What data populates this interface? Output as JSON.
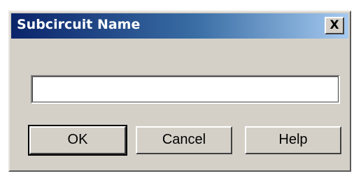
{
  "window": {
    "title": "Subcircuit Name",
    "close_label": "X"
  },
  "form": {
    "name_value": ""
  },
  "buttons": {
    "ok_label": "OK",
    "cancel_label": "Cancel",
    "help_label": "Help"
  },
  "colors": {
    "title_bar_start": "#0a246a",
    "title_bar_end": "#a6caf0",
    "dialog_face": "#d4d0c8"
  }
}
